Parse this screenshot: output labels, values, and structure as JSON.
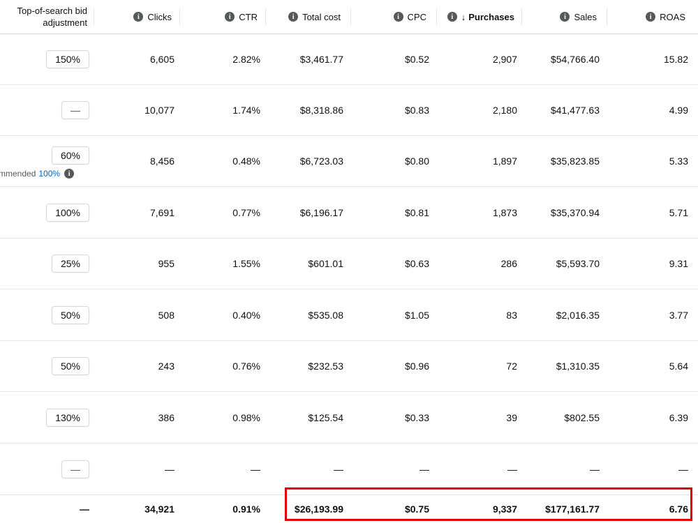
{
  "header": {
    "bid_adjustment_line1": "Top-of-search bid",
    "bid_adjustment_line2": "adjustment",
    "columns": [
      {
        "key": "clicks",
        "label": "Clicks"
      },
      {
        "key": "ctr",
        "label": "CTR"
      },
      {
        "key": "total_cost",
        "label": "Total cost"
      },
      {
        "key": "cpc",
        "label": "CPC"
      },
      {
        "key": "purchases",
        "label": "Purchases",
        "sort": "↓"
      },
      {
        "key": "sales",
        "label": "Sales"
      },
      {
        "key": "roas",
        "label": "ROAS"
      }
    ]
  },
  "rows": [
    {
      "bid": "150%",
      "clicks": "6,605",
      "ctr": "2.82%",
      "total_cost": "$3,461.77",
      "cpc": "$0.52",
      "purchases": "2,907",
      "sales": "$54,766.40",
      "roas": "15.82"
    },
    {
      "bid": "—",
      "clicks": "10,077",
      "ctr": "1.74%",
      "total_cost": "$8,318.86",
      "cpc": "$0.83",
      "purchases": "2,180",
      "sales": "$41,477.63",
      "roas": "4.99"
    },
    {
      "bid": "60%",
      "clicks": "8,456",
      "ctr": "0.48%",
      "total_cost": "$6,723.03",
      "cpc": "$0.80",
      "purchases": "1,897",
      "sales": "$35,823.85",
      "roas": "5.33",
      "recommended_prefix": "mmended",
      "recommended_value": "100%"
    },
    {
      "bid": "100%",
      "clicks": "7,691",
      "ctr": "0.77%",
      "total_cost": "$6,196.17",
      "cpc": "$0.81",
      "purchases": "1,873",
      "sales": "$35,370.94",
      "roas": "5.71"
    },
    {
      "bid": "25%",
      "clicks": "955",
      "ctr": "1.55%",
      "total_cost": "$601.01",
      "cpc": "$0.63",
      "purchases": "286",
      "sales": "$5,593.70",
      "roas": "9.31"
    },
    {
      "bid": "50%",
      "clicks": "508",
      "ctr": "0.40%",
      "total_cost": "$535.08",
      "cpc": "$1.05",
      "purchases": "83",
      "sales": "$2,016.35",
      "roas": "3.77"
    },
    {
      "bid": "50%",
      "clicks": "243",
      "ctr": "0.76%",
      "total_cost": "$232.53",
      "cpc": "$0.96",
      "purchases": "72",
      "sales": "$1,310.35",
      "roas": "5.64"
    },
    {
      "bid": "130%",
      "clicks": "386",
      "ctr": "0.98%",
      "total_cost": "$125.54",
      "cpc": "$0.33",
      "purchases": "39",
      "sales": "$802.55",
      "roas": "6.39"
    },
    {
      "bid": "—",
      "clicks": "—",
      "ctr": "—",
      "total_cost": "—",
      "cpc": "—",
      "purchases": "—",
      "sales": "—",
      "roas": "—"
    }
  ],
  "totals": {
    "bid": "—",
    "clicks": "34,921",
    "ctr": "0.91%",
    "total_cost": "$26,193.99",
    "cpc": "$0.75",
    "purchases": "9,337",
    "sales": "$177,161.77",
    "roas": "6.76"
  },
  "icons": {
    "info": "info-icon",
    "sort": "arrow-down-icon"
  },
  "colors": {
    "highlight": "#e30000",
    "link": "#0066c0"
  }
}
